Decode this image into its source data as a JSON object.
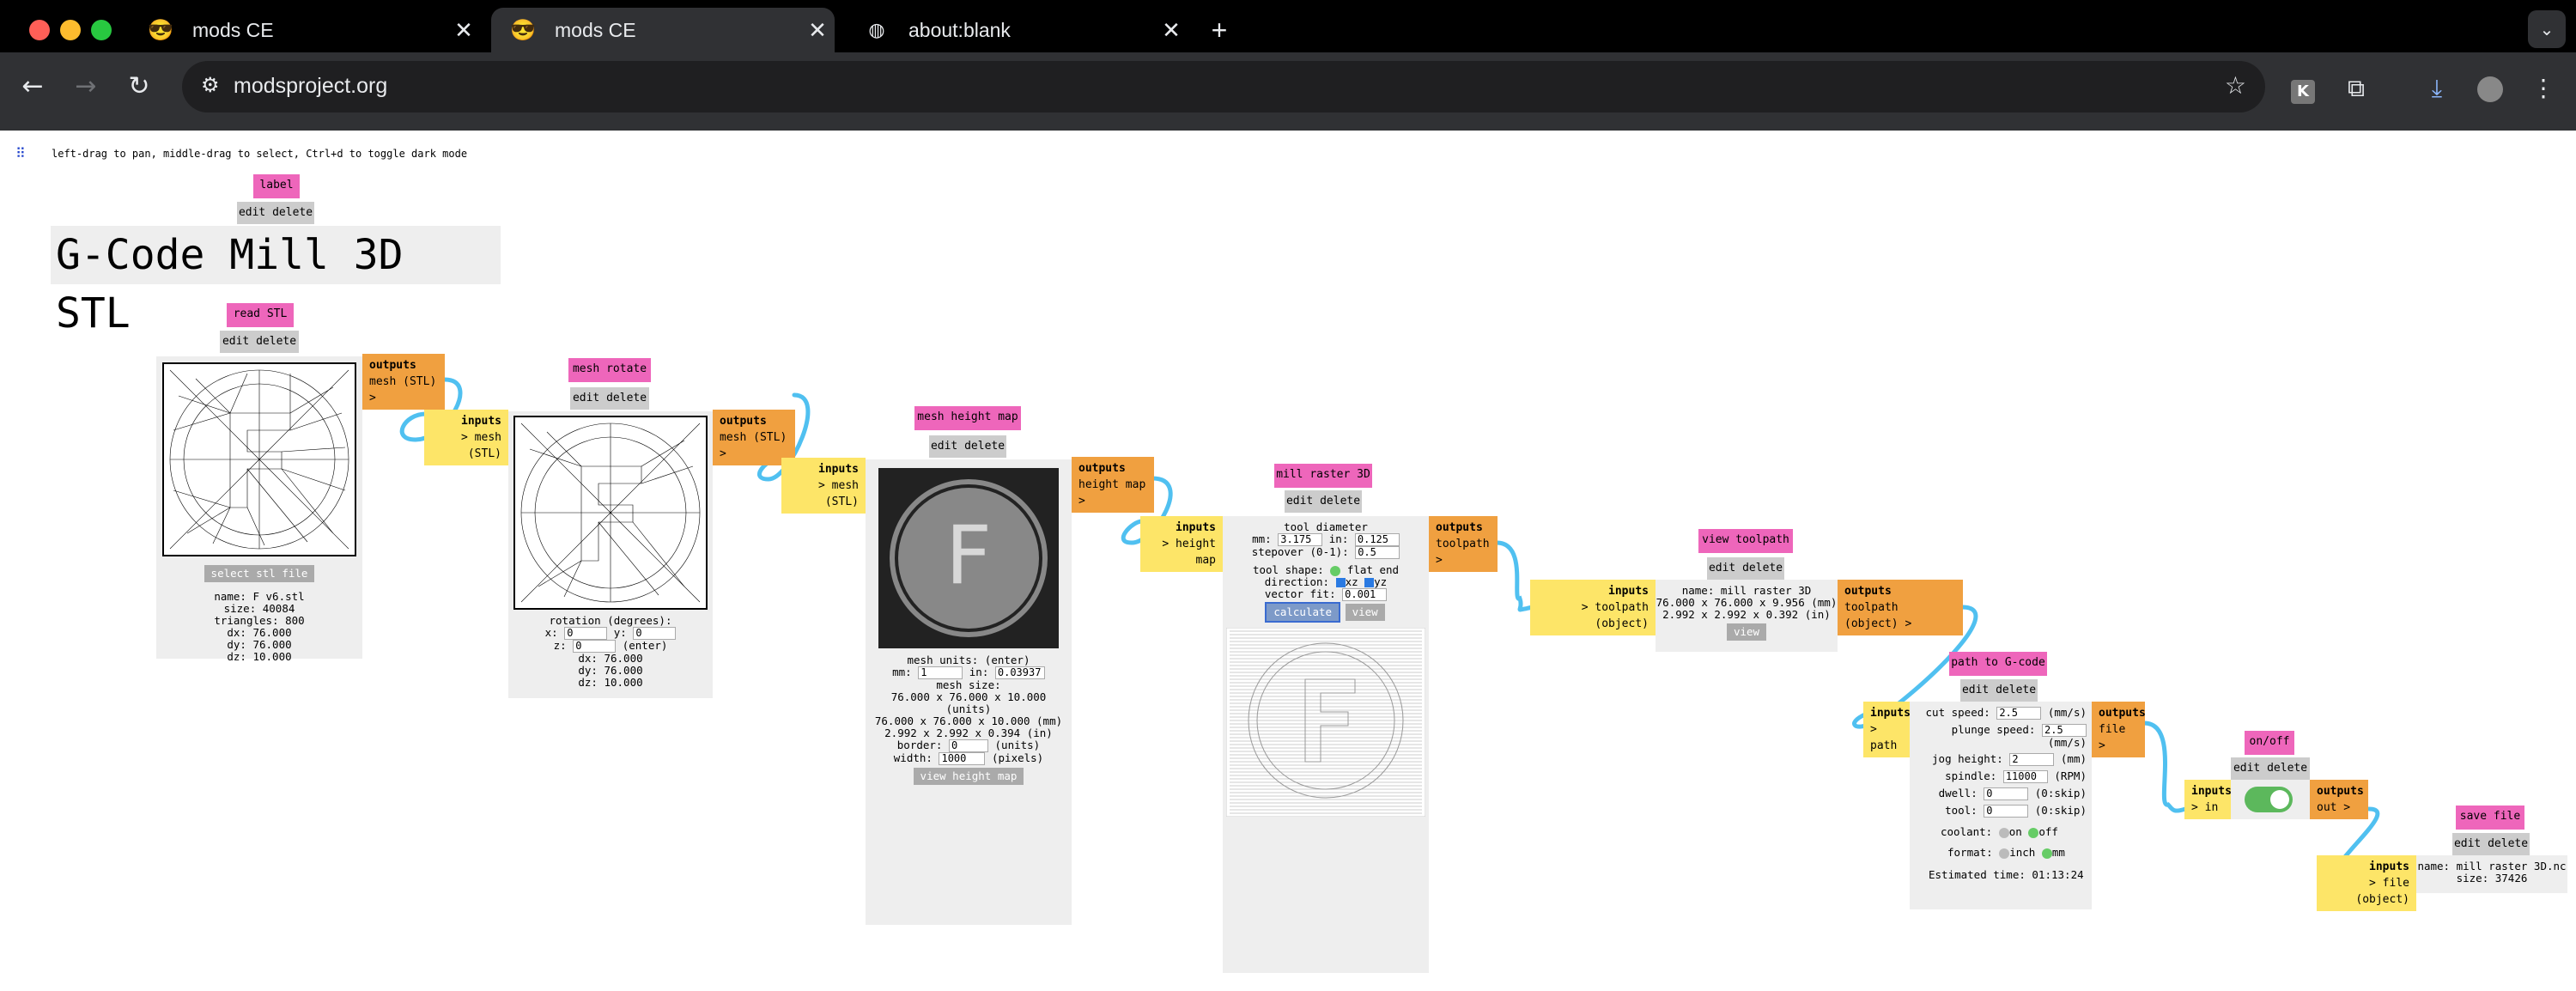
{
  "browser": {
    "tabs": [
      {
        "title": "mods CE",
        "icon": "sunglasses-emoji"
      },
      {
        "title": "mods CE",
        "icon": "sunglasses-emoji"
      },
      {
        "title": "about:blank",
        "icon": "globe-icon"
      }
    ],
    "url": "modsproject.org"
  },
  "page": {
    "hint": "left-drag to pan, middle-drag to select, Ctrl+d to toggle dark mode",
    "title": "G-Code Mill 3D STL",
    "edit_delete": "edit delete",
    "outputs": "outputs",
    "inputs": "inputs",
    "modules": {
      "label": {
        "name": "label"
      },
      "read_stl": {
        "name": "read STL",
        "button": "select stl file",
        "info": [
          "name: F v6.stl",
          "size: 40084",
          "triangles: 800",
          "dx: 76.000",
          "dy: 76.000",
          "dz: 10.000"
        ],
        "output": "mesh (STL) >"
      },
      "mesh_rotate": {
        "name": "mesh rotate",
        "input": "> mesh (STL)",
        "output": "mesh (STL) >",
        "rot_label": "rotation (degrees):",
        "x_label": "x:",
        "x": "0",
        "y_label": "y:",
        "y": "0",
        "z_label": "z:",
        "z": "0",
        "enter": "(enter)",
        "dims": [
          "dx: 76.000",
          "dy: 76.000",
          "dz: 10.000"
        ]
      },
      "height_map": {
        "name": "mesh height map",
        "input": "> mesh (STL)",
        "output": "height map >",
        "letter": "F",
        "units_label": "mesh units: (enter)",
        "mm_label": "mm:",
        "mm": "1",
        "in_label": "in:",
        "in": "0.03937",
        "size_label": "mesh size:",
        "sizes": [
          "76.000 x 76.000 x 10.000 (units)",
          "76.000 x 76.000 x 10.000 (mm)",
          "2.992 x 2.992 x 0.394 (in)"
        ],
        "border_label": "border:",
        "border": "0",
        "border_unit": "(units)",
        "width_label": "width:",
        "width": "1000",
        "width_unit": "(pixels)",
        "button": "view height map"
      },
      "mill_raster": {
        "name": "mill raster 3D",
        "input": "> height map",
        "output": "toolpath >",
        "tool_diameter": "tool diameter",
        "mm_label": "mm:",
        "mm": "3.175",
        "in_label": "in:",
        "in": "0.125",
        "stepover_label": "stepover (0-1):",
        "stepover": "0.5",
        "shape_label": "tool shape:",
        "shape": "flat end",
        "direction_label": "direction:",
        "dir1": "xz",
        "dir2": "yz",
        "vfit_label": "vector fit:",
        "vfit": "0.001",
        "calculate": "calculate",
        "view": "view"
      },
      "view_toolpath": {
        "name": "view toolpath",
        "input": "> toolpath (object)",
        "output": "toolpath (object) >",
        "info": [
          "name: mill raster 3D",
          "76.000 x 76.000 x 9.956 (mm)",
          "2.992 x 2.992 x 0.392 (in)"
        ],
        "view": "view"
      },
      "gcode": {
        "name": "path to G-code",
        "input": "> path",
        "output": "file >",
        "rows": [
          {
            "label": "cut speed:",
            "value": "2.5",
            "unit": "(mm/s)"
          },
          {
            "label": "plunge speed:",
            "value": "2.5",
            "unit": "(mm/s)"
          },
          {
            "label": "jog height:",
            "value": "2",
            "unit": "(mm)"
          },
          {
            "label": "spindle:",
            "value": "11000",
            "unit": "(RPM)"
          },
          {
            "label": "dwell:",
            "value": "0",
            "unit": "(0:skip)"
          },
          {
            "label": "tool:",
            "value": "0",
            "unit": "(0:skip)"
          }
        ],
        "coolant_label": "coolant:",
        "on": "on",
        "off": "off",
        "format_label": "format:",
        "inch": "inch",
        "mm": "mm",
        "estimate": "Estimated time: 01:13:24"
      },
      "onoff": {
        "name": "on/off",
        "input": "> in",
        "output": "out >",
        "state": "on"
      },
      "save_file": {
        "name": "save file",
        "input": "> file (object)",
        "info": [
          "name: mill raster 3D.nc",
          "size: 37426"
        ]
      }
    }
  },
  "colors": {
    "label": "#ee66bb",
    "outputs": "#f0a040",
    "inputs": "#fde568",
    "wire": "#50c0f0",
    "panel": "#eeeeee"
  }
}
